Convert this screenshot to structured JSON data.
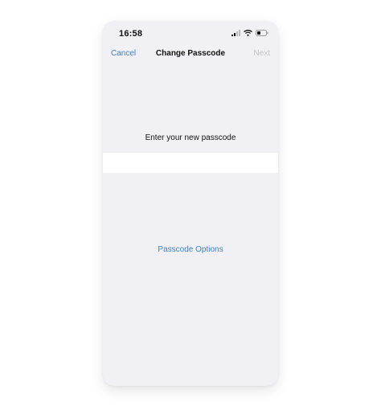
{
  "status_bar": {
    "time": "16:58",
    "icons": [
      "cellular-signal-icon",
      "wifi-icon",
      "battery-icon"
    ]
  },
  "nav": {
    "cancel_label": "Cancel",
    "title": "Change Passcode",
    "next_label": "Next"
  },
  "main": {
    "prompt": "Enter your new passcode",
    "passcode_value": "",
    "options_label": "Passcode Options"
  },
  "colors": {
    "accent": "#3b82c9",
    "disabled": "#c2c2c8",
    "background": "#f1f1f5",
    "field": "#ffffff"
  }
}
